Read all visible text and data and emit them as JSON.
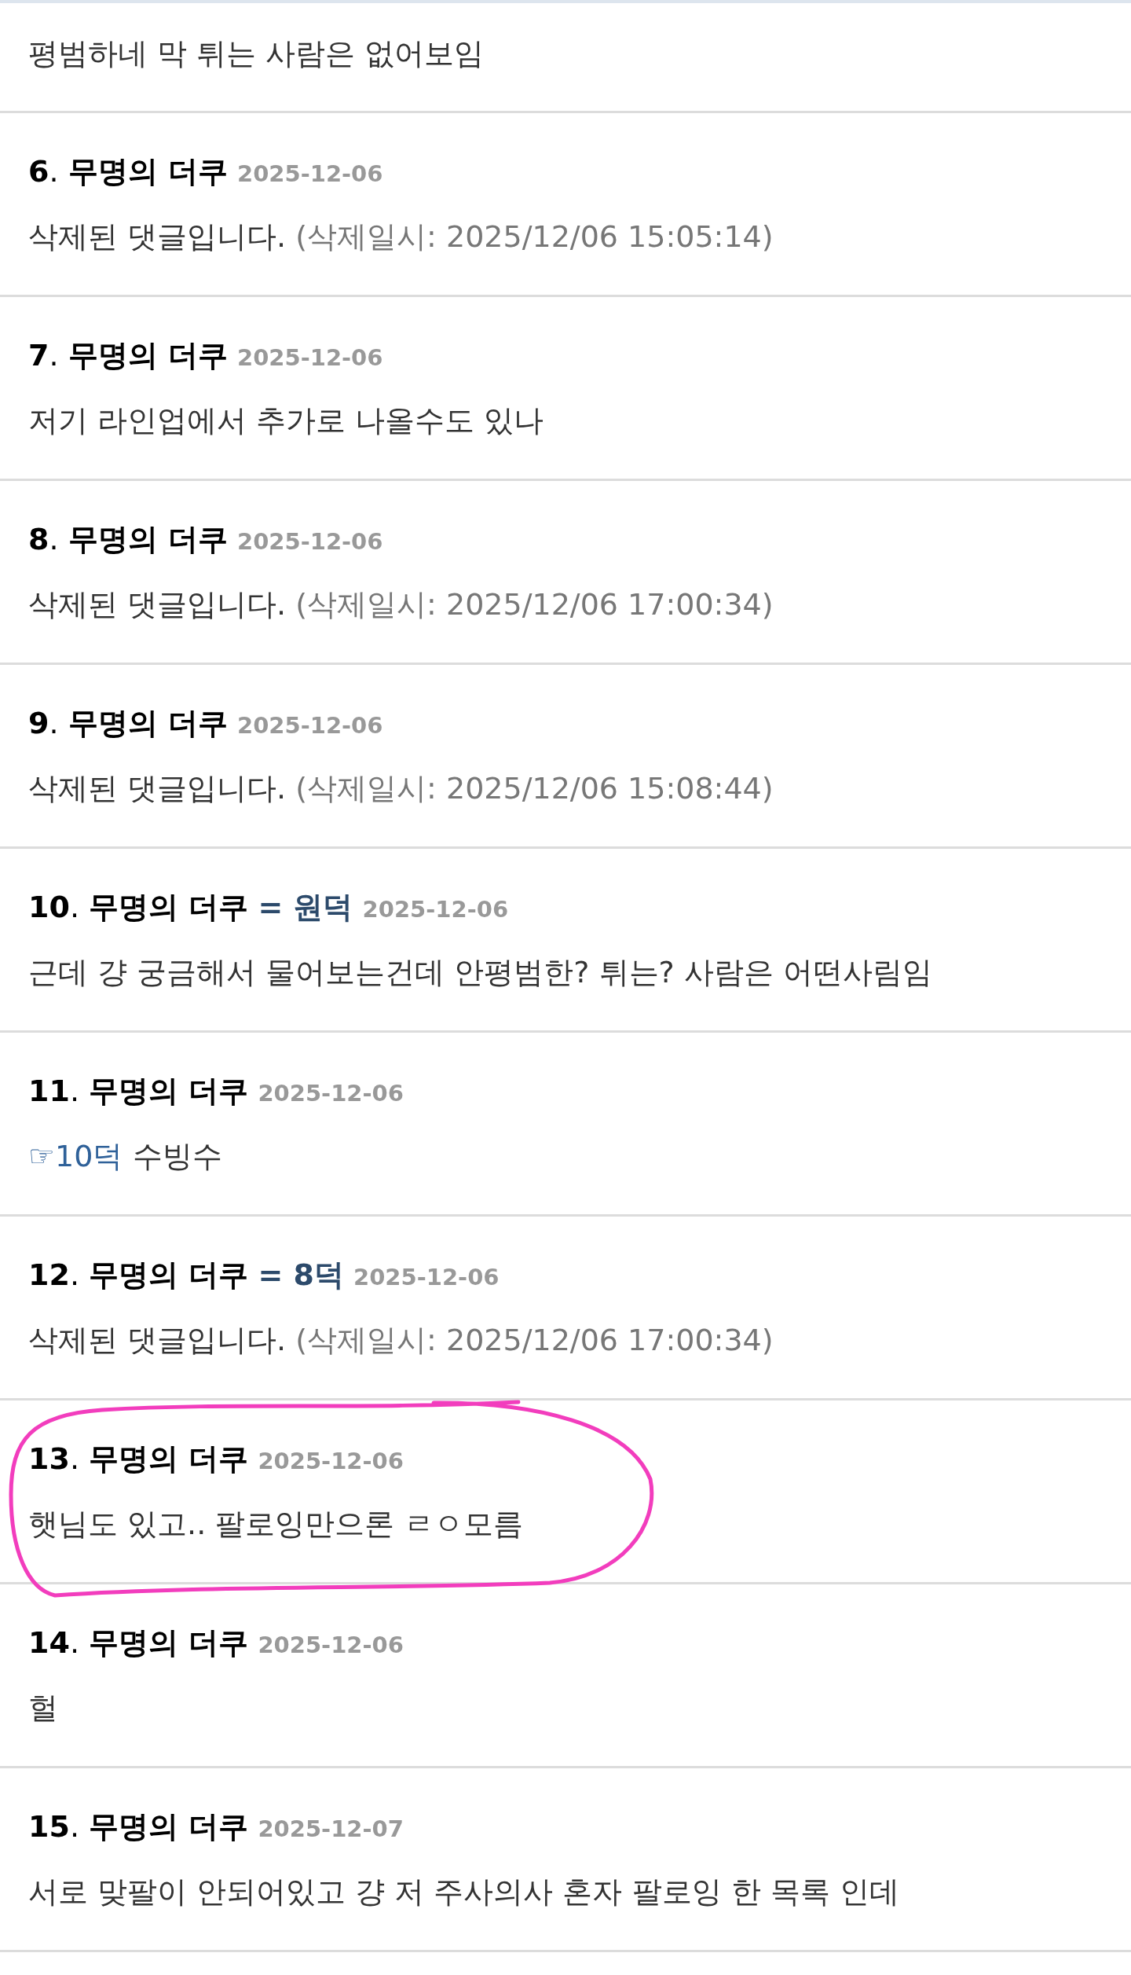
{
  "comments": [
    {
      "body": [
        {
          "kind": "plain",
          "text": "평범하네 막 튀는 사람은 없어보임"
        }
      ],
      "highlighted": false
    },
    {
      "number": "**6**.",
      "author": "무명의 더쿠",
      "date": "2025-12-06",
      "body": [
        {
          "kind": "plain",
          "text": "삭제된 댓글입니다."
        },
        {
          "kind": "muted",
          "text": "(삭제일시: 2025/12/06 15:05:14)"
        }
      ],
      "highlighted": false
    },
    {
      "number": "**7**.",
      "author": "무명의 더쿠",
      "date": "2025-12-06",
      "body": [
        {
          "kind": "plain",
          "text": "저기 라인업에서 추가로 나올수도 있나"
        }
      ],
      "highlighted": false
    },
    {
      "number": "**8**.",
      "author": "무명의 더쿠",
      "date": "2025-12-06",
      "body": [
        {
          "kind": "plain",
          "text": "삭제된 댓글입니다."
        },
        {
          "kind": "muted",
          "text": "(삭제일시: 2025/12/06 17:00:34)"
        }
      ],
      "highlighted": false
    },
    {
      "number": "**9**.",
      "author": "무명의 더쿠",
      "date": "2025-12-06",
      "body": [
        {
          "kind": "plain",
          "text": "삭제된 댓글입니다."
        },
        {
          "kind": "muted",
          "text": "(삭제일시: 2025/12/06 15:08:44)"
        }
      ],
      "highlighted": false
    },
    {
      "number": "**10**.",
      "author": "무명의 더쿠",
      "reply_to": "= 원덕",
      "date": "2025-12-06",
      "body": [
        {
          "kind": "plain",
          "text": "근데 걍 궁금해서 물어보는건데 안평범한? 튀는? 사람은 어떤사림임"
        }
      ],
      "highlighted": false
    },
    {
      "number": "**11**.",
      "author": "무명의 더쿠",
      "date": "2025-12-06",
      "body": [
        {
          "kind": "link",
          "text": "☞10덕"
        },
        {
          "kind": "plain",
          "text": "수빙수"
        }
      ],
      "highlighted": false
    },
    {
      "number": "**12**.",
      "author": "무명의 더쿠",
      "reply_to": "= 8덕",
      "date": "2025-12-06",
      "body": [
        {
          "kind": "plain",
          "text": "삭제된 댓글입니다."
        },
        {
          "kind": "muted",
          "text": "(삭제일시: 2025/12/06 17:00:34)"
        }
      ],
      "highlighted": false
    },
    {
      "number": "**13**.",
      "author": "무명의 더쿠",
      "date": "2025-12-06",
      "body": [
        {
          "kind": "plain",
          "text": "햇님도 있고.. 팔로잉만으론 ㄹㅇ모름"
        }
      ],
      "highlighted": true
    },
    {
      "number": "**14**.",
      "author": "무명의 더쿠",
      "date": "2025-12-06",
      "body": [
        {
          "kind": "plain",
          "text": "헐"
        }
      ],
      "highlighted": false
    },
    {
      "number": "**15**.",
      "author": "무명의 더쿠",
      "date": "2025-12-07",
      "body": [
        {
          "kind": "plain",
          "text": "서로 맞팔이 안되어있고 걍 저 주사의사 혼자 팔로잉 한 목록 인데"
        }
      ],
      "highlighted": false
    }
  ]
}
